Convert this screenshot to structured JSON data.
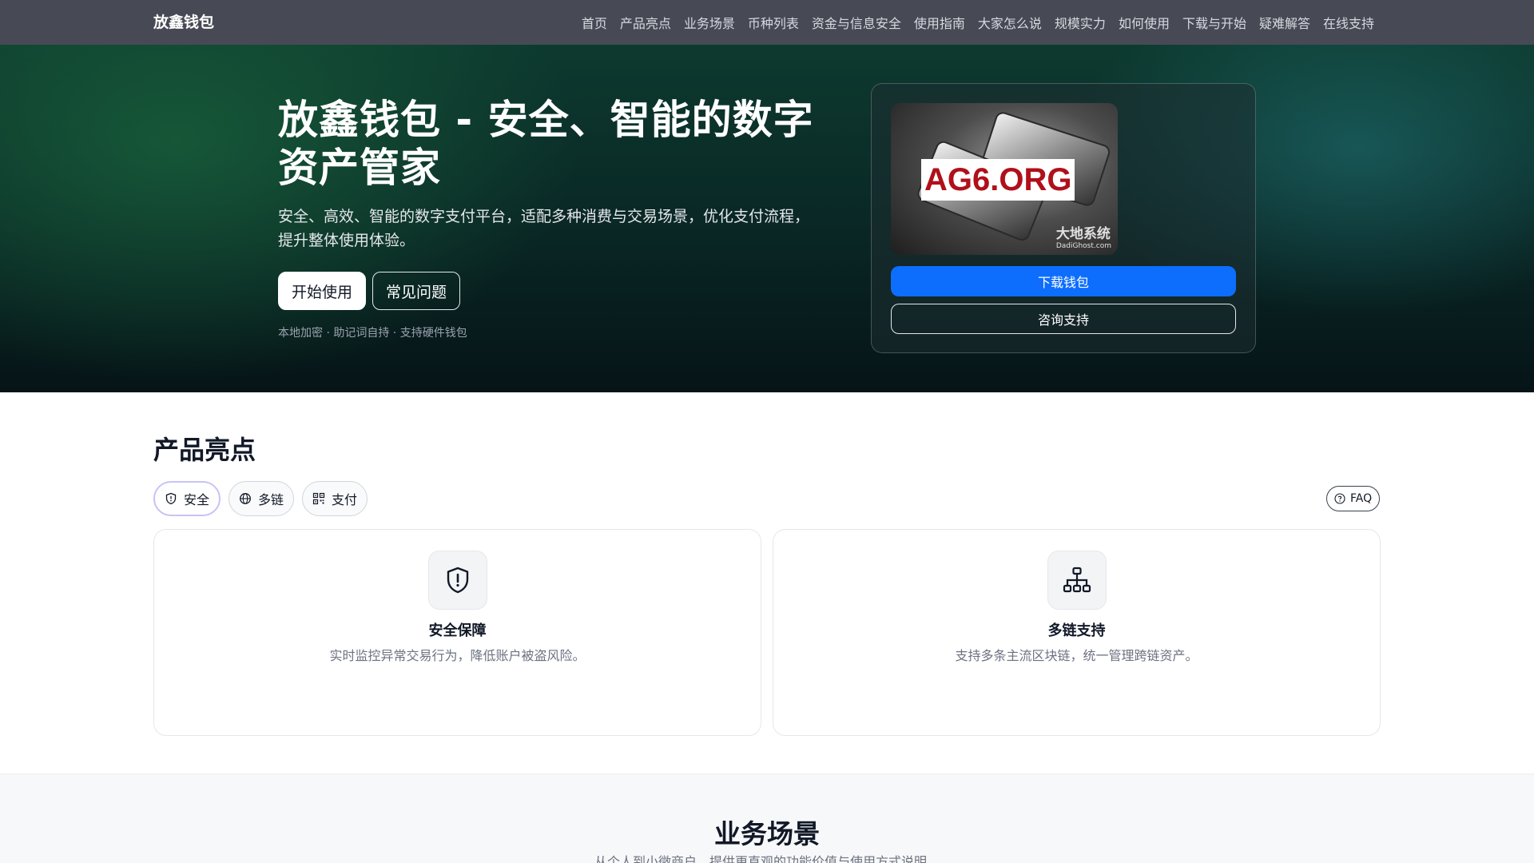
{
  "nav": {
    "brand": "放鑫钱包",
    "links": [
      "首页",
      "产品亮点",
      "业务场景",
      "币种列表",
      "资金与信息安全",
      "使用指南",
      "大家怎么说",
      "规模实力",
      "如何使用",
      "下载与开始",
      "疑难解答",
      "在线支持"
    ]
  },
  "hero": {
    "title": "放鑫钱包 - 安全、智能的数字资产管家",
    "subtitle": "安全、高效、智能的数字支付平台，适配多种消费与交易场景，优化支付流程，提升整体使用体验。",
    "primary_button": "开始使用",
    "secondary_button": "常见问题",
    "note": "本地加密 · 助记词自持 · 支持硬件钱包"
  },
  "download_card": {
    "image_label": "AG6.ORG",
    "image_watermark": "大地系统",
    "image_watermark_sub": "DadiGhost.com",
    "download_button": "下载钱包",
    "consult_button": "咨询支持"
  },
  "highlights": {
    "title": "产品亮点",
    "pills": [
      {
        "label": "安全",
        "icon": "shield-icon"
      },
      {
        "label": "多链",
        "icon": "globe-icon"
      },
      {
        "label": "支付",
        "icon": "qrcode-icon"
      }
    ],
    "faq_label": "FAQ",
    "cards": [
      {
        "title": "安全保障",
        "desc": "实时监控异常交易行为，降低账户被盗风险。",
        "icon": "shield-alert-icon"
      },
      {
        "title": "多链支持",
        "desc": "支持多条主流区块链，统一管理跨链资产。",
        "icon": "network-icon"
      }
    ]
  },
  "business": {
    "title": "业务场景",
    "subtitle": "从个人到小微商户，提供更直观的功能价值与使用方式说明。"
  },
  "colors": {
    "nav_bg": "#474a55",
    "accent_blue": "#0d6efd",
    "hero_dark": "#0a2a27"
  }
}
